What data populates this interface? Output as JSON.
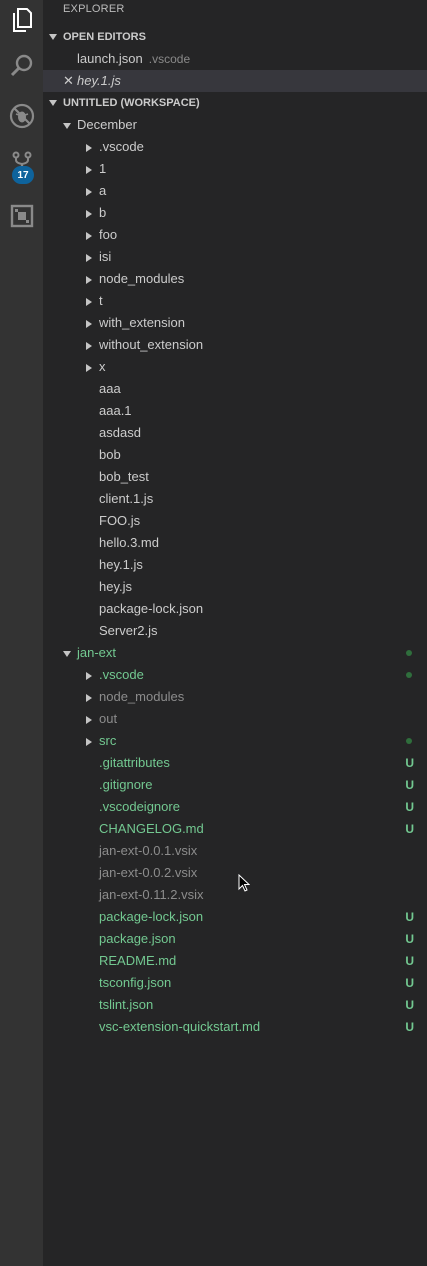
{
  "colors": {
    "activity_bar": "#333333",
    "sidebar": "#252526",
    "untracked_green": "#73c991",
    "ignored_grey": "#8c8c8c",
    "badge_blue": "#0e639c",
    "dot_green": "#2f6e3c"
  },
  "activity_bar": {
    "items": [
      {
        "icon": "files-icon",
        "active": true
      },
      {
        "icon": "search-icon",
        "active": false
      },
      {
        "icon": "debug-icon",
        "active": false
      },
      {
        "icon": "source-control-icon",
        "active": false
      },
      {
        "icon": "extensions-icon",
        "active": false
      }
    ],
    "scm_badge": "17"
  },
  "explorer": {
    "title": "EXPLORER",
    "open_editors": {
      "header": "OPEN EDITORS",
      "items": [
        {
          "name": "launch.json",
          "description": ".vscode"
        },
        {
          "name": "hey.1.js",
          "close_glyph": "✕"
        }
      ]
    },
    "workspace": {
      "header": "UNTITLED (WORKSPACE)",
      "december": {
        "name": "December",
        "folders": [
          ".vscode",
          "1",
          "a",
          "b",
          "foo",
          "isi",
          "node_modules",
          "t",
          "with_extension",
          "without_extension",
          "x"
        ],
        "files": [
          "aaa",
          "aaa.1",
          "asdasd",
          "bob",
          "bob_test",
          "client.1.js",
          "FOO.js",
          "hello.3.md",
          "hey.1.js",
          "hey.js",
          "package-lock.json",
          "Server2.js"
        ]
      },
      "jan_ext": {
        "name": "jan-ext",
        "folders": [
          {
            "name": ".vscode",
            "status": "modified-dot"
          },
          {
            "name": "node_modules",
            "status": "ignored"
          },
          {
            "name": "out",
            "status": "ignored"
          },
          {
            "name": "src",
            "status": "modified-dot"
          }
        ],
        "files": [
          {
            "name": ".gitattributes",
            "badge": "U"
          },
          {
            "name": ".gitignore",
            "badge": "U"
          },
          {
            "name": ".vscodeignore",
            "badge": "U"
          },
          {
            "name": "CHANGELOG.md",
            "badge": "U"
          },
          {
            "name": "jan-ext-0.0.1.vsix",
            "badge": ""
          },
          {
            "name": "jan-ext-0.0.2.vsix",
            "badge": ""
          },
          {
            "name": "jan-ext-0.11.2.vsix",
            "badge": ""
          },
          {
            "name": "package-lock.json",
            "badge": "U"
          },
          {
            "name": "package.json",
            "badge": "U"
          },
          {
            "name": "README.md",
            "badge": "U"
          },
          {
            "name": "tsconfig.json",
            "badge": "U"
          },
          {
            "name": "tslint.json",
            "badge": "U"
          },
          {
            "name": "vsc-extension-quickstart.md",
            "badge": "U"
          }
        ]
      }
    }
  }
}
